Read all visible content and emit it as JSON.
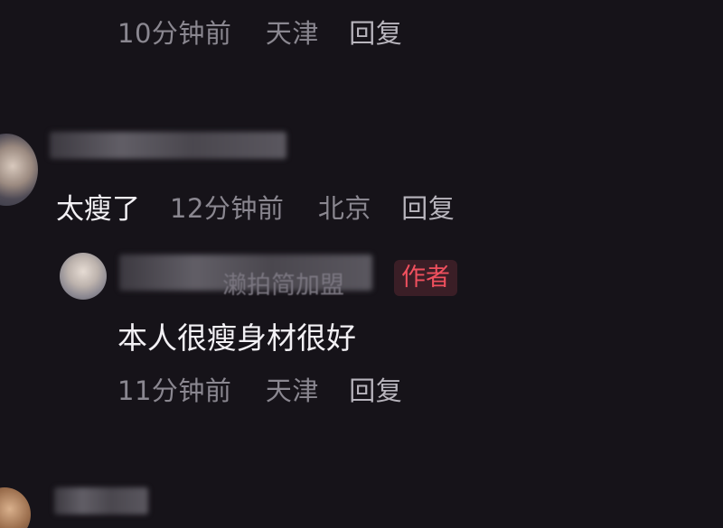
{
  "comment_top_reply": {
    "time": "10分钟前",
    "location": "天津",
    "reply_label": "回复"
  },
  "comment_main": {
    "username_partial": "ᴰᴰ吾 ᴰᴰᴰᴰᴰᴰᴰ",
    "text": "太瘦了",
    "time": "12分钟前",
    "location": "北京",
    "reply_label": "回复"
  },
  "author_reply": {
    "username_partial": "濑拍简加盟",
    "author_badge": "作者",
    "text": "本人很瘦身材很好",
    "time": "11分钟前",
    "location": "天津",
    "reply_label": "回复"
  },
  "colors": {
    "background": "#161319",
    "author_badge": "#f0505e",
    "meta_text": "#8a8790",
    "primary_text": "#f2f0f4"
  }
}
